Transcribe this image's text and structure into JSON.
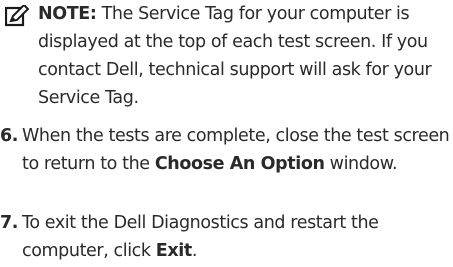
{
  "note": {
    "icon": "note-pencil-icon",
    "label": "NOTE:",
    "text": " The Service Tag for your computer is displayed at the top of each test screen. If you contact Dell, technical support will ask for your Service Tag."
  },
  "steps": [
    {
      "number": "6.",
      "text_before": "When the tests are complete, close the test screen to return to the ",
      "bold": "Choose An Option",
      "text_after": " window."
    },
    {
      "number": "7.",
      "text_before": "To exit the Dell Diagnostics and restart the computer, click ",
      "bold": "Exit",
      "text_after": "."
    }
  ]
}
